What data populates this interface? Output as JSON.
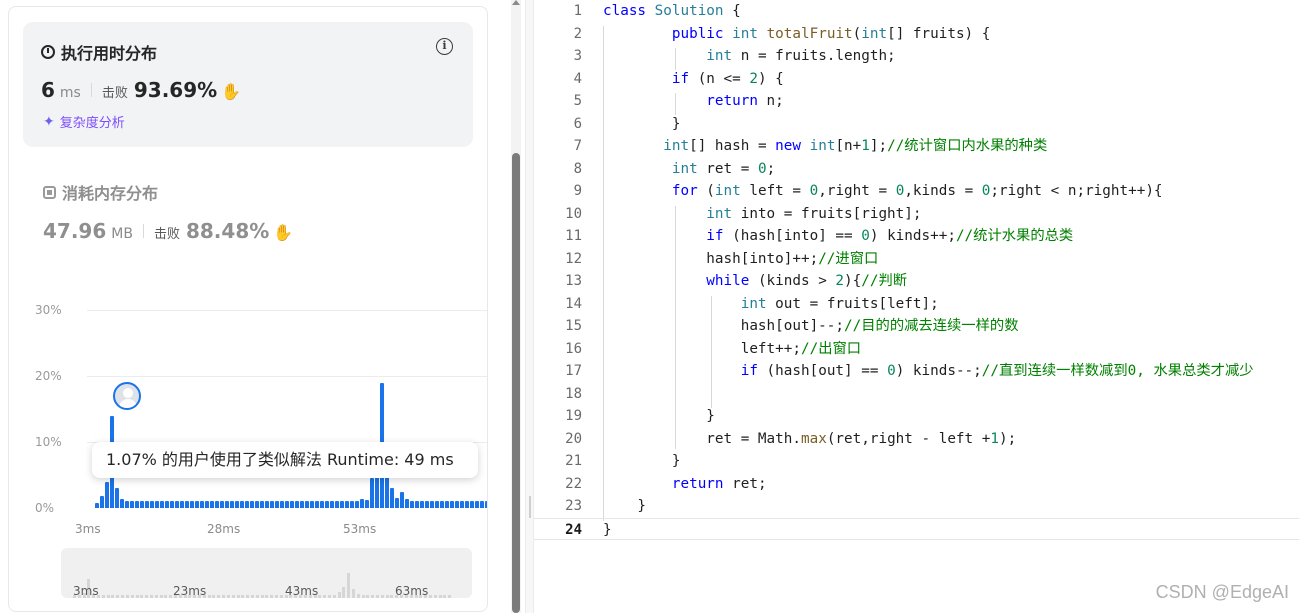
{
  "runtime": {
    "title": "执行用时分布",
    "value": "6",
    "unit": "ms",
    "beat_label": "击败",
    "beat_value": "93.69%",
    "analysis_link": "复杂度分析"
  },
  "memory": {
    "title": "消耗内存分布",
    "value": "47.96",
    "unit": "MB",
    "beat_label": "击败",
    "beat_value": "88.48%"
  },
  "chart_data": {
    "type": "bar",
    "y_ticks": [
      "30%",
      "20%",
      "10%",
      "0%"
    ],
    "x_ticks": [
      "3ms",
      "28ms",
      "53ms"
    ],
    "ylim": [
      0,
      30
    ],
    "tooltip": "1.07% 的用户使用了类似解法 Runtime: 49 ms",
    "values": [
      0.8,
      1.8,
      4,
      14,
      3,
      1.3,
      1,
      1,
      1,
      1,
      1,
      1,
      1,
      1,
      1,
      1,
      1,
      1,
      1,
      1,
      1,
      1,
      1,
      1,
      1,
      1,
      1,
      1,
      1,
      1,
      1,
      1,
      1,
      1,
      1,
      1,
      1,
      1,
      1,
      1,
      1,
      1,
      1,
      1,
      1,
      1,
      1,
      1,
      1,
      1,
      1,
      1,
      1,
      1.4,
      1.2,
      4.5,
      8.5,
      19,
      7,
      3,
      1.5,
      2.5,
      1.4,
      1,
      1,
      1,
      1,
      1,
      1,
      1,
      1,
      1,
      1,
      1,
      1,
      1,
      1,
      1,
      1
    ]
  },
  "overview": {
    "x_ticks": [
      "3ms",
      "23ms",
      "43ms",
      "63ms"
    ]
  },
  "editor": {
    "lines": [
      {
        "n": "1",
        "code": "class Solution {"
      },
      {
        "n": "2",
        "code": "        public int totalFruit(int[] fruits) {"
      },
      {
        "n": "3",
        "code": "            int n = fruits.length;"
      },
      {
        "n": "4",
        "code": "        if (n <= 2) {"
      },
      {
        "n": "5",
        "code": "            return n;"
      },
      {
        "n": "6",
        "code": "        }"
      },
      {
        "n": "7",
        "code": "       int[] hash = new int[n+1];//统计窗口内水果的种类"
      },
      {
        "n": "8",
        "code": "        int ret = 0;"
      },
      {
        "n": "9",
        "code": "        for (int left = 0,right = 0,kinds = 0;right < n;right++){"
      },
      {
        "n": "10",
        "code": "            int into = fruits[right];"
      },
      {
        "n": "11",
        "code": "            if (hash[into] == 0) kinds++;//统计水果的总类"
      },
      {
        "n": "12",
        "code": "            hash[into]++;//进窗口"
      },
      {
        "n": "13",
        "code": "            while (kinds > 2){//判断"
      },
      {
        "n": "14",
        "code": "                int out = fruits[left];"
      },
      {
        "n": "15",
        "code": "                hash[out]--;//目的的减去连续一样的数"
      },
      {
        "n": "16",
        "code": "                left++;//出窗口"
      },
      {
        "n": "17",
        "code": "                if (hash[out] == 0) kinds--;//直到连续一样数减到0, 水果总类才减少"
      },
      {
        "n": "18",
        "code": ""
      },
      {
        "n": "19",
        "code": "            }"
      },
      {
        "n": "20",
        "code": "            ret = Math.max(ret,right - left +1);"
      },
      {
        "n": "21",
        "code": "        }"
      },
      {
        "n": "22",
        "code": "        return ret;"
      },
      {
        "n": "23",
        "code": "    }"
      },
      {
        "n": "24",
        "code": "}"
      }
    ]
  },
  "watermark": "CSDN @EdgeAI",
  "colors": {
    "bar": "#1a73e8",
    "keyword": "#0000ff",
    "type": "#267f99",
    "number": "#098658",
    "comment": "#008000",
    "beat_icon": "#2db55d",
    "analysis": "#7c4dff"
  }
}
